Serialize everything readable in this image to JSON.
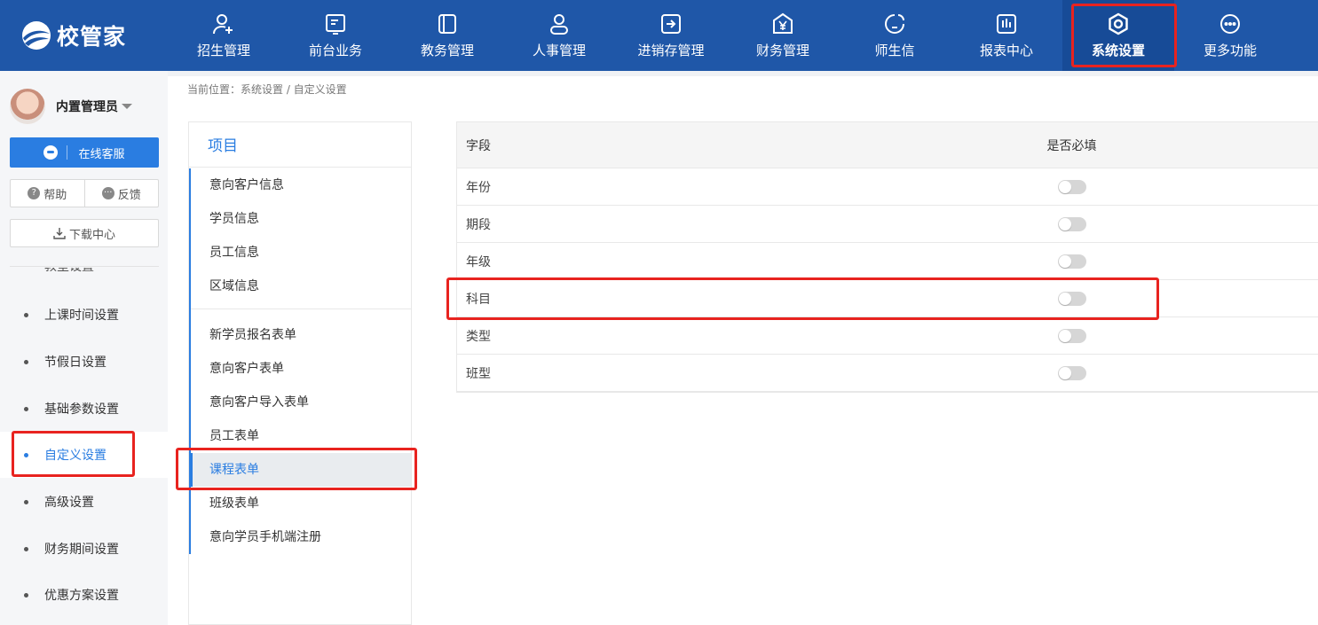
{
  "app": {
    "logo_text": "校管家"
  },
  "nav": {
    "items": [
      {
        "label": "招生管理",
        "icon": "user-add-icon"
      },
      {
        "label": "前台业务",
        "icon": "id-card-icon"
      },
      {
        "label": "教务管理",
        "icon": "book-icon"
      },
      {
        "label": "人事管理",
        "icon": "person-icon"
      },
      {
        "label": "进销存管理",
        "icon": "inventory-icon"
      },
      {
        "label": "财务管理",
        "icon": "yen-icon"
      },
      {
        "label": "师生信",
        "icon": "chat-bubble-icon"
      },
      {
        "label": "报表中心",
        "icon": "bar-chart-icon"
      },
      {
        "label": "系统设置",
        "icon": "gear-icon",
        "active": true
      },
      {
        "label": "更多功能",
        "icon": "more-icon"
      }
    ]
  },
  "sidebar": {
    "user_name": "内置管理员",
    "service_label": "在线客服",
    "help_label": "帮助",
    "feedback_label": "反馈",
    "download_label": "下载中心",
    "clipped_item": "教室设置",
    "menu": [
      {
        "label": "上课时间设置"
      },
      {
        "label": "节假日设置"
      },
      {
        "label": "基础参数设置"
      },
      {
        "label": "自定义设置",
        "active": true
      },
      {
        "label": "高级设置"
      },
      {
        "label": "财务期间设置"
      },
      {
        "label": "优惠方案设置"
      }
    ]
  },
  "breadcrumb": "当前位置：系统设置 / 自定义设置",
  "project": {
    "title": "项目",
    "group1": [
      "意向客户信息",
      "学员信息",
      "员工信息",
      "区域信息"
    ],
    "group2": [
      "新学员报名表单",
      "意向客户表单",
      "意向客户导入表单",
      "员工表单",
      "课程表单",
      "班级表单",
      "意向学员手机端注册"
    ],
    "active": "课程表单"
  },
  "table": {
    "col_field": "字段",
    "col_required": "是否必填",
    "rows": [
      {
        "field": "年份",
        "required": false
      },
      {
        "field": "期段",
        "required": false
      },
      {
        "field": "年级",
        "required": false
      },
      {
        "field": "科目",
        "required": false
      },
      {
        "field": "类型",
        "required": false
      },
      {
        "field": "班型",
        "required": false
      }
    ]
  },
  "colors": {
    "nav_bg": "#1f57a8",
    "accent": "#2a7de1",
    "highlight": "#e8231f"
  }
}
